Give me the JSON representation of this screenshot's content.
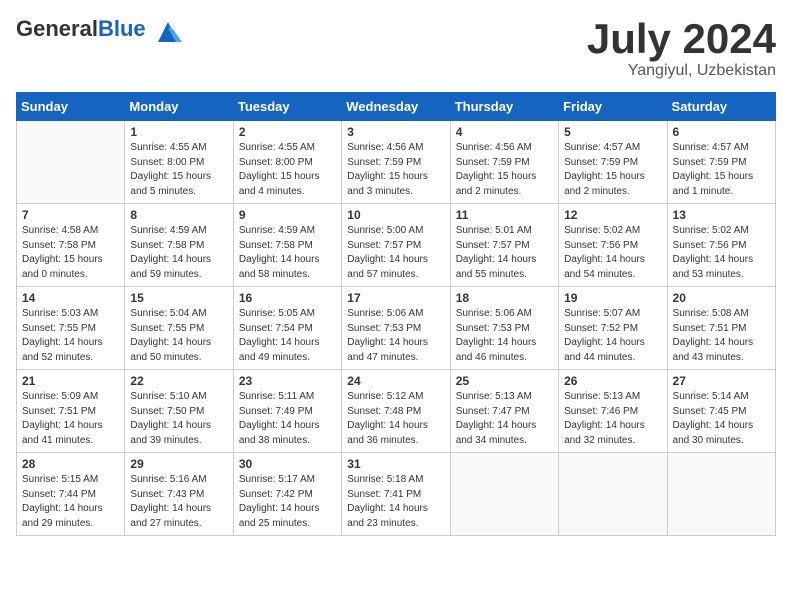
{
  "logo": {
    "general": "General",
    "blue": "Blue"
  },
  "header": {
    "month": "July 2024",
    "location": "Yangiyul, Uzbekistan"
  },
  "weekdays": [
    "Sunday",
    "Monday",
    "Tuesday",
    "Wednesday",
    "Thursday",
    "Friday",
    "Saturday"
  ],
  "weeks": [
    [
      {
        "day": "",
        "info": ""
      },
      {
        "day": "1",
        "info": "Sunrise: 4:55 AM\nSunset: 8:00 PM\nDaylight: 15 hours\nand 5 minutes."
      },
      {
        "day": "2",
        "info": "Sunrise: 4:55 AM\nSunset: 8:00 PM\nDaylight: 15 hours\nand 4 minutes."
      },
      {
        "day": "3",
        "info": "Sunrise: 4:56 AM\nSunset: 7:59 PM\nDaylight: 15 hours\nand 3 minutes."
      },
      {
        "day": "4",
        "info": "Sunrise: 4:56 AM\nSunset: 7:59 PM\nDaylight: 15 hours\nand 2 minutes."
      },
      {
        "day": "5",
        "info": "Sunrise: 4:57 AM\nSunset: 7:59 PM\nDaylight: 15 hours\nand 2 minutes."
      },
      {
        "day": "6",
        "info": "Sunrise: 4:57 AM\nSunset: 7:59 PM\nDaylight: 15 hours\nand 1 minute."
      }
    ],
    [
      {
        "day": "7",
        "info": "Sunrise: 4:58 AM\nSunset: 7:58 PM\nDaylight: 15 hours\nand 0 minutes."
      },
      {
        "day": "8",
        "info": "Sunrise: 4:59 AM\nSunset: 7:58 PM\nDaylight: 14 hours\nand 59 minutes."
      },
      {
        "day": "9",
        "info": "Sunrise: 4:59 AM\nSunset: 7:58 PM\nDaylight: 14 hours\nand 58 minutes."
      },
      {
        "day": "10",
        "info": "Sunrise: 5:00 AM\nSunset: 7:57 PM\nDaylight: 14 hours\nand 57 minutes."
      },
      {
        "day": "11",
        "info": "Sunrise: 5:01 AM\nSunset: 7:57 PM\nDaylight: 14 hours\nand 55 minutes."
      },
      {
        "day": "12",
        "info": "Sunrise: 5:02 AM\nSunset: 7:56 PM\nDaylight: 14 hours\nand 54 minutes."
      },
      {
        "day": "13",
        "info": "Sunrise: 5:02 AM\nSunset: 7:56 PM\nDaylight: 14 hours\nand 53 minutes."
      }
    ],
    [
      {
        "day": "14",
        "info": "Sunrise: 5:03 AM\nSunset: 7:55 PM\nDaylight: 14 hours\nand 52 minutes."
      },
      {
        "day": "15",
        "info": "Sunrise: 5:04 AM\nSunset: 7:55 PM\nDaylight: 14 hours\nand 50 minutes."
      },
      {
        "day": "16",
        "info": "Sunrise: 5:05 AM\nSunset: 7:54 PM\nDaylight: 14 hours\nand 49 minutes."
      },
      {
        "day": "17",
        "info": "Sunrise: 5:06 AM\nSunset: 7:53 PM\nDaylight: 14 hours\nand 47 minutes."
      },
      {
        "day": "18",
        "info": "Sunrise: 5:06 AM\nSunset: 7:53 PM\nDaylight: 14 hours\nand 46 minutes."
      },
      {
        "day": "19",
        "info": "Sunrise: 5:07 AM\nSunset: 7:52 PM\nDaylight: 14 hours\nand 44 minutes."
      },
      {
        "day": "20",
        "info": "Sunrise: 5:08 AM\nSunset: 7:51 PM\nDaylight: 14 hours\nand 43 minutes."
      }
    ],
    [
      {
        "day": "21",
        "info": "Sunrise: 5:09 AM\nSunset: 7:51 PM\nDaylight: 14 hours\nand 41 minutes."
      },
      {
        "day": "22",
        "info": "Sunrise: 5:10 AM\nSunset: 7:50 PM\nDaylight: 14 hours\nand 39 minutes."
      },
      {
        "day": "23",
        "info": "Sunrise: 5:11 AM\nSunset: 7:49 PM\nDaylight: 14 hours\nand 38 minutes."
      },
      {
        "day": "24",
        "info": "Sunrise: 5:12 AM\nSunset: 7:48 PM\nDaylight: 14 hours\nand 36 minutes."
      },
      {
        "day": "25",
        "info": "Sunrise: 5:13 AM\nSunset: 7:47 PM\nDaylight: 14 hours\nand 34 minutes."
      },
      {
        "day": "26",
        "info": "Sunrise: 5:13 AM\nSunset: 7:46 PM\nDaylight: 14 hours\nand 32 minutes."
      },
      {
        "day": "27",
        "info": "Sunrise: 5:14 AM\nSunset: 7:45 PM\nDaylight: 14 hours\nand 30 minutes."
      }
    ],
    [
      {
        "day": "28",
        "info": "Sunrise: 5:15 AM\nSunset: 7:44 PM\nDaylight: 14 hours\nand 29 minutes."
      },
      {
        "day": "29",
        "info": "Sunrise: 5:16 AM\nSunset: 7:43 PM\nDaylight: 14 hours\nand 27 minutes."
      },
      {
        "day": "30",
        "info": "Sunrise: 5:17 AM\nSunset: 7:42 PM\nDaylight: 14 hours\nand 25 minutes."
      },
      {
        "day": "31",
        "info": "Sunrise: 5:18 AM\nSunset: 7:41 PM\nDaylight: 14 hours\nand 23 minutes."
      },
      {
        "day": "",
        "info": ""
      },
      {
        "day": "",
        "info": ""
      },
      {
        "day": "",
        "info": ""
      }
    ]
  ]
}
